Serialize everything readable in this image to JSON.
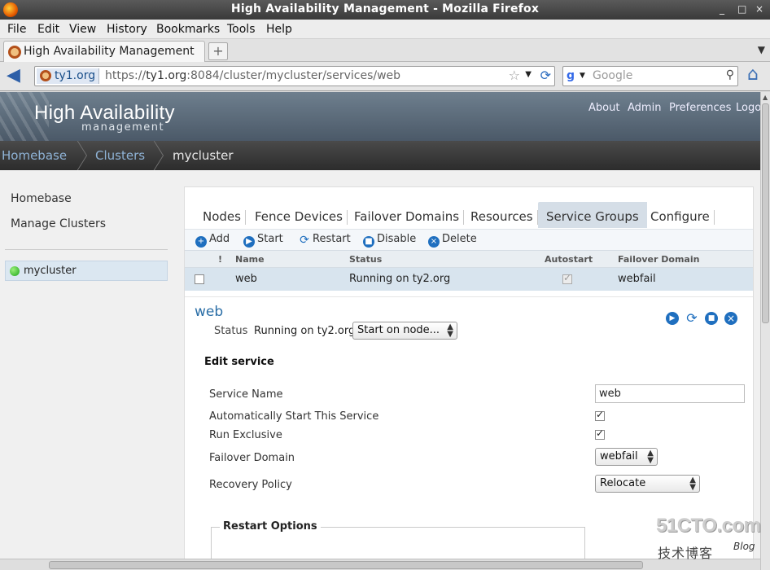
{
  "window": {
    "title": "High Availability Management - Mozilla Firefox",
    "controls": [
      "_",
      "□",
      "×"
    ]
  },
  "menu": [
    "File",
    "Edit",
    "View",
    "History",
    "Bookmarks",
    "Tools",
    "Help"
  ],
  "browser_tab": {
    "label": "High Availability Management",
    "new_tab": "+"
  },
  "address": {
    "site": "ty1.org",
    "url_prefix": "https://",
    "url_host": "ty1.org",
    "url_rest": ":8084/cluster/mycluster/services/web",
    "search_placeholder": "Google"
  },
  "header": {
    "brand": "High Availability",
    "sub": "management",
    "links": [
      "About",
      "Admin",
      "Preferences",
      "Logo"
    ]
  },
  "breadcrumb": [
    "Homebase",
    "Clusters",
    "mycluster"
  ],
  "sidebar": {
    "links": [
      "Homebase",
      "Manage Clusters"
    ],
    "cluster": "mycluster"
  },
  "tabs": [
    "Nodes",
    "Fence Devices",
    "Failover Domains",
    "Resources",
    "Service Groups",
    "Configure"
  ],
  "active_tab": "Service Groups",
  "toolbar": [
    "Add",
    "Start",
    "Restart",
    "Disable",
    "Delete"
  ],
  "table": {
    "columns": [
      "!",
      "Name",
      "Status",
      "Autostart",
      "Failover Domain"
    ],
    "rows": [
      {
        "name": "web",
        "status": "Running on ty2.org",
        "autostart": true,
        "failover": "webfail"
      }
    ]
  },
  "service": {
    "title": "web",
    "status_label": "Status",
    "status_value": "Running on ty2.org",
    "start_on_node": "Start on node...",
    "edit_title": "Edit service",
    "fields": {
      "name_label": "Service Name",
      "name_value": "web",
      "autostart_label": "Automatically Start This Service",
      "autostart": true,
      "exclusive_label": "Run Exclusive",
      "exclusive": true,
      "failover_label": "Failover Domain",
      "failover_value": "webfail",
      "recovery_label": "Recovery Policy",
      "recovery_value": "Relocate"
    },
    "restart_legend": "Restart Options"
  },
  "watermark": {
    "line1": "51CTO.com",
    "line2": "技术博客",
    "line3": "Blog"
  }
}
